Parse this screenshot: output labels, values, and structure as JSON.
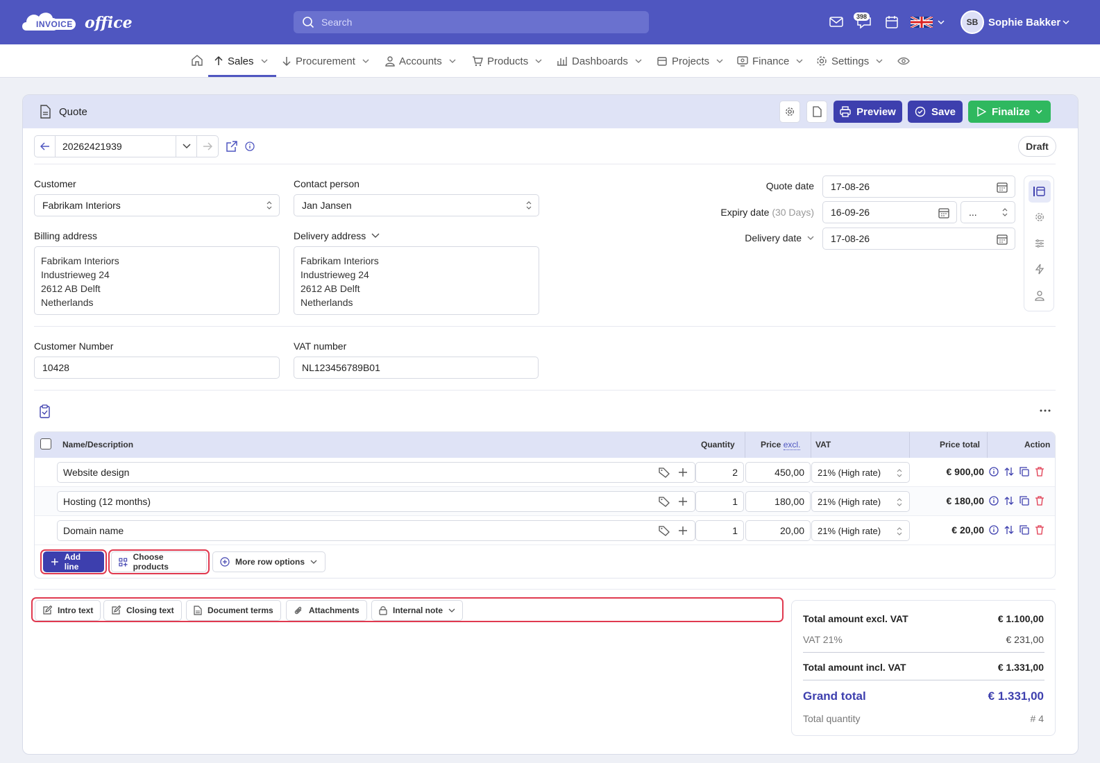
{
  "app": {
    "logo_text_1": "INVOICE",
    "logo_text_2": "office"
  },
  "search": {
    "placeholder": "Search"
  },
  "topbar": {
    "notification_count": "398",
    "user_initials": "SB",
    "user_name": "Sophie Bakker"
  },
  "nav": {
    "items": [
      {
        "label": "Sales"
      },
      {
        "label": "Procurement"
      },
      {
        "label": "Accounts"
      },
      {
        "label": "Products"
      },
      {
        "label": "Dashboards"
      },
      {
        "label": "Projects"
      },
      {
        "label": "Finance"
      },
      {
        "label": "Settings"
      }
    ]
  },
  "header": {
    "title": "Quote",
    "preview": "Preview",
    "save": "Save",
    "finalize": "Finalize"
  },
  "doc": {
    "number": "20262421939",
    "status": "Draft"
  },
  "form": {
    "customer_label": "Customer",
    "customer": "Fabrikam Interiors",
    "contact_label": "Contact person",
    "contact": "Jan Jansen",
    "billing_label": "Billing address",
    "billing": [
      "Fabrikam Interiors",
      "Industrieweg 24",
      "2612 AB Delft",
      "Netherlands"
    ],
    "delivery_label": "Delivery address",
    "delivery": [
      "Fabrikam Interiors",
      "Industrieweg 24",
      "2612 AB Delft",
      "Netherlands"
    ],
    "quote_date_label": "Quote date",
    "quote_date": "17-08-26",
    "expiry_label": "Expiry date",
    "expiry_hint": "(30 Days)",
    "expiry_date": "16-09-26",
    "expiry_select": "...",
    "delivery_date_label": "Delivery date",
    "delivery_date": "17-08-26",
    "custnum_label": "Customer Number",
    "custnum": "10428",
    "vat_label": "VAT number",
    "vat": "NL123456789B01"
  },
  "table": {
    "headers": {
      "name": "Name/Description",
      "qty": "Quantity",
      "price": "Price",
      "price_sub": "excl.",
      "vat": "VAT",
      "total": "Price total",
      "action": "Action"
    },
    "rows": [
      {
        "name": "Website design",
        "qty": "2",
        "price": "450,00",
        "vat": "21% (High rate)",
        "total": "€ 900,00"
      },
      {
        "name": "Hosting (12 months)",
        "qty": "1",
        "price": "180,00",
        "vat": "21% (High rate)",
        "total": "€ 180,00"
      },
      {
        "name": "Domain name",
        "qty": "1",
        "price": "20,00",
        "vat": "21% (High rate)",
        "total": "€ 20,00"
      }
    ],
    "add_line": "Add line",
    "choose_products": "Choose products",
    "more_row_options": "More row options"
  },
  "tabs": {
    "intro": "Intro text",
    "closing": "Closing text",
    "terms": "Document terms",
    "attachments": "Attachments",
    "note": "Internal note"
  },
  "totals": {
    "excl_label": "Total amount excl. VAT",
    "excl": "€ 1.100,00",
    "vat_label": "VAT 21%",
    "vat": "€ 231,00",
    "incl_label": "Total amount incl. VAT",
    "incl": "€ 1.331,00",
    "grand_label": "Grand total",
    "grand": "€ 1.331,00",
    "qty_label": "Total quantity",
    "qty": "# 4"
  },
  "colors": {
    "brand": "#4f56c0",
    "primary_button": "#3d3fae",
    "finalize": "#2fb85f",
    "highlight": "#e0394f"
  }
}
